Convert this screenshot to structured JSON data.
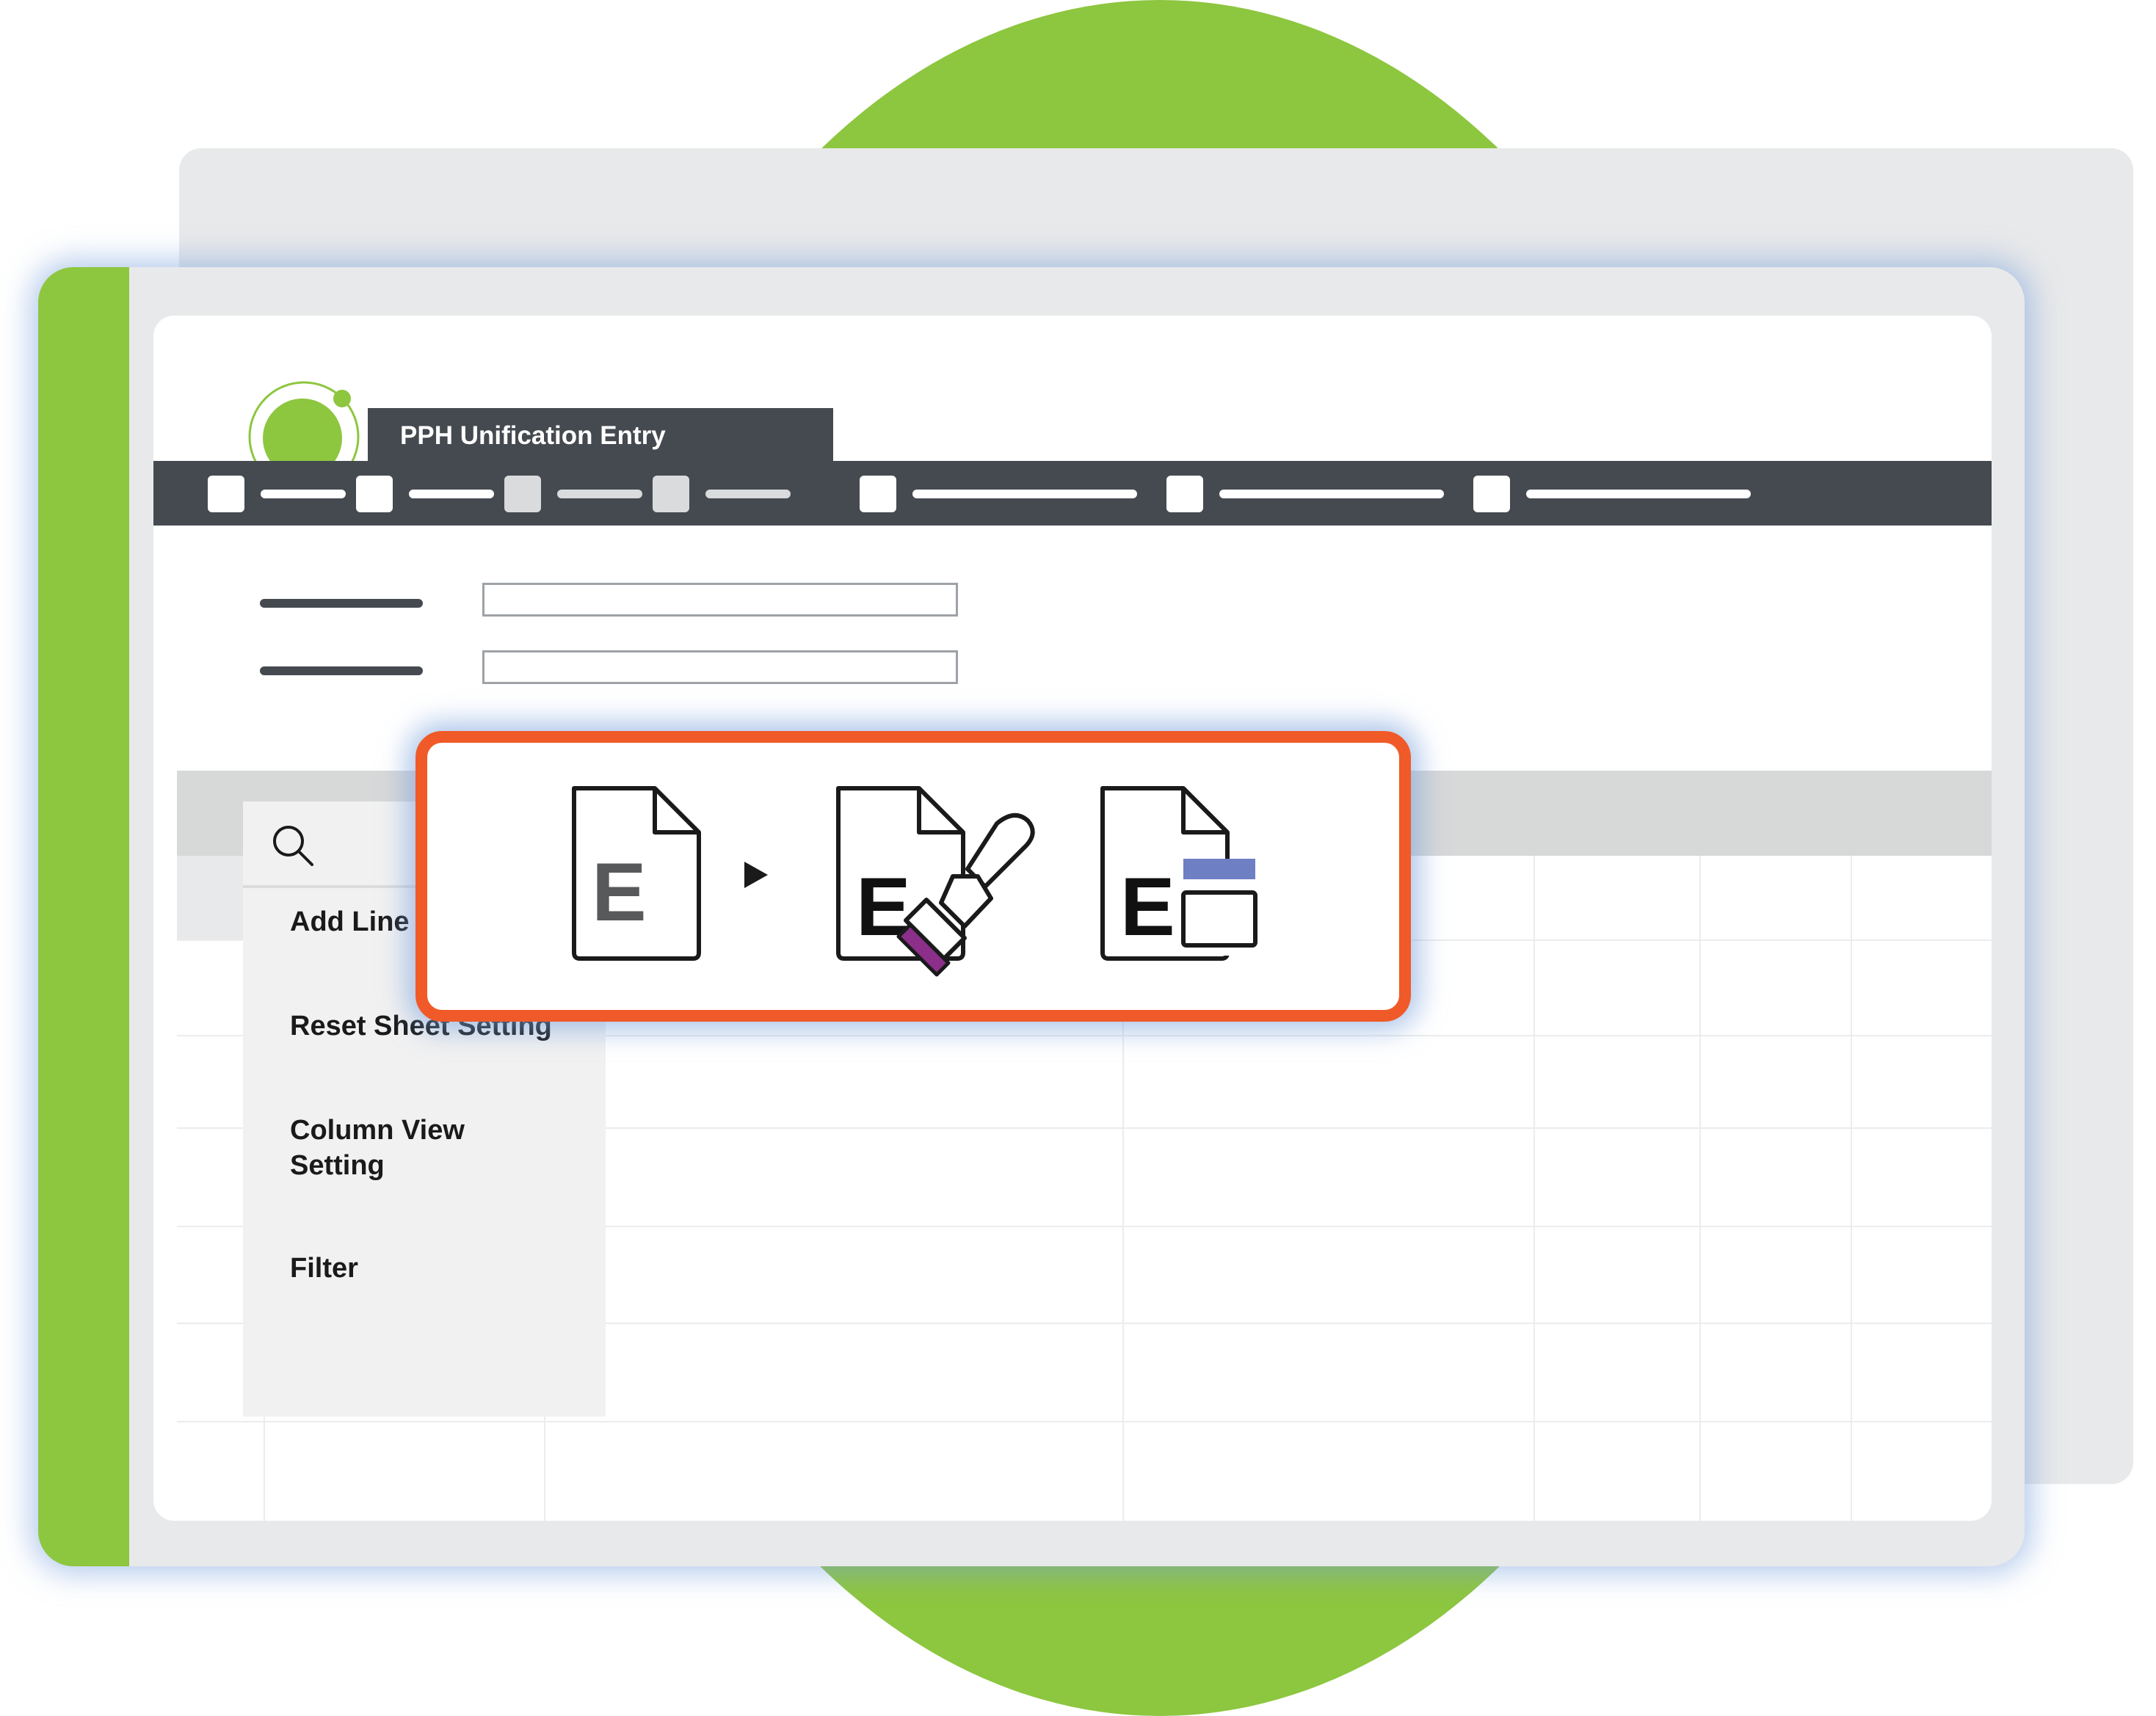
{
  "window": {
    "title": "PPH Unification Entry"
  },
  "context_menu": {
    "items": [
      {
        "label": "Add Line"
      },
      {
        "label": "Reset Sheet Setting"
      },
      {
        "label": "Column View Setting"
      },
      {
        "label": "Filter"
      }
    ]
  },
  "callout": {
    "icons": [
      {
        "name": "excel-document-icon",
        "letter": "E"
      },
      {
        "name": "play-arrow-icon"
      },
      {
        "name": "excel-format-brush-icon",
        "letter": "E"
      },
      {
        "name": "excel-layout-icon",
        "letter": "E"
      }
    ]
  },
  "colors": {
    "brand_green": "#8dc63f",
    "toolbar_dark": "#454a50",
    "callout_border": "#f05a28",
    "brush_purple": "#8b2f8b",
    "layout_blue": "#6f7fc4"
  }
}
